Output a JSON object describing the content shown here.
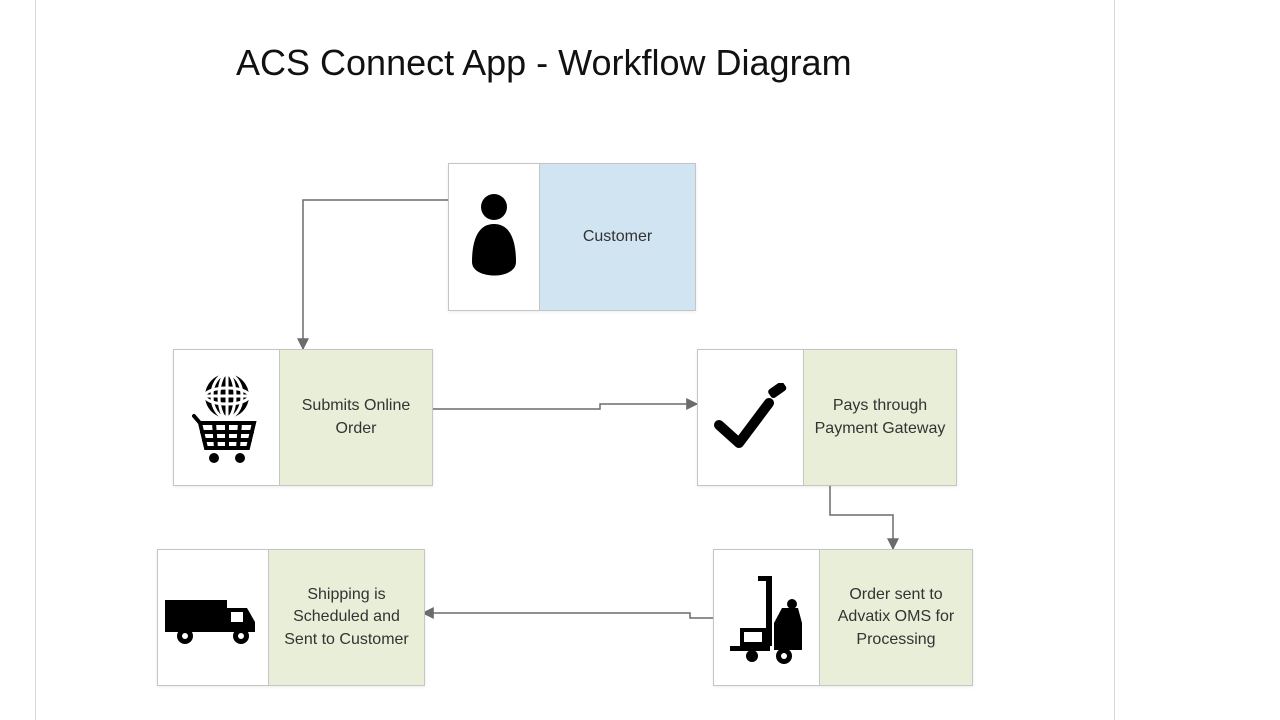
{
  "title": "ACS Connect App - Workflow Diagram",
  "nodes": {
    "customer": {
      "label": "Customer"
    },
    "submit": {
      "label": "Submits Online Order"
    },
    "pay": {
      "label": "Pays through Payment Gateway"
    },
    "oms": {
      "label": "Order sent to Advatix OMS for Processing"
    },
    "ship": {
      "label": "Shipping is Scheduled and Sent to Customer"
    }
  },
  "flow": [
    [
      "customer",
      "submit"
    ],
    [
      "submit",
      "pay"
    ],
    [
      "pay",
      "oms"
    ],
    [
      "oms",
      "ship"
    ]
  ]
}
